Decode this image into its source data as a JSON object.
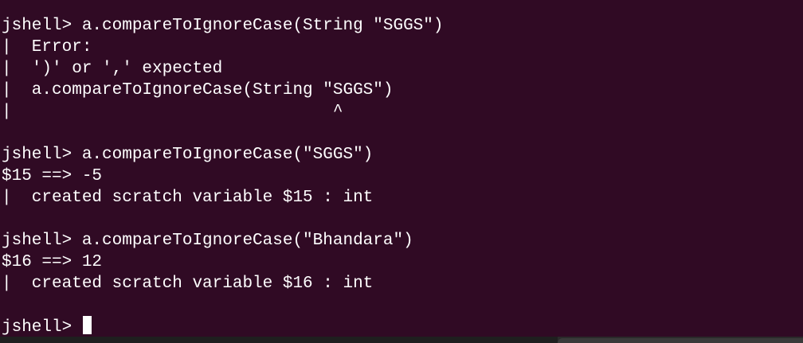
{
  "terminal": {
    "lines": [
      "jshell> a.compareToIgnoreCase(String \"SGGS\")",
      "|  Error:",
      "|  ')' or ',' expected",
      "|  a.compareToIgnoreCase(String \"SGGS\")",
      "|                                ^",
      "",
      "jshell> a.compareToIgnoreCase(\"SGGS\")",
      "$15 ==> -5",
      "|  created scratch variable $15 : int",
      "",
      "jshell> a.compareToIgnoreCase(\"Bhandara\")",
      "$16 ==> 12",
      "|  created scratch variable $16 : int",
      ""
    ],
    "prompt": "jshell> "
  },
  "colors": {
    "background": "#300a24",
    "foreground": "#ffffff"
  }
}
